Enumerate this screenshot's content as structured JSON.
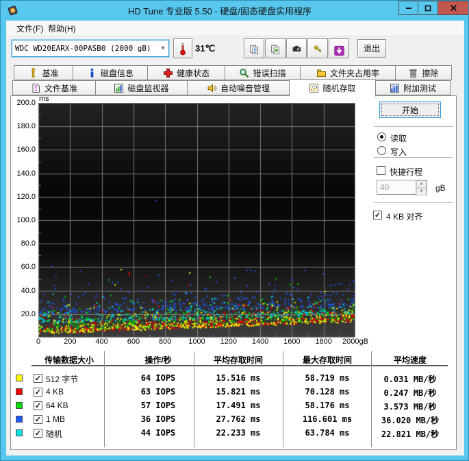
{
  "window": {
    "title": "HD Tune 专业版 5.50 - 硬盘/固态硬盘实用程序",
    "controls": {
      "minimize": "–",
      "maximize": "□",
      "close": "x"
    }
  },
  "menu": {
    "items": [
      "文件(F)",
      "帮助(H)"
    ]
  },
  "toolbar": {
    "drive": "WDC WD20EARX-00PASB0  (2000 gB)",
    "temperature": "31℃",
    "exit_label": "退出",
    "buttons": [
      {
        "icon": "copy-text-icon"
      },
      {
        "icon": "copy-image-icon"
      },
      {
        "icon": "camera-icon"
      },
      {
        "icon": "key-icon"
      },
      {
        "icon": "download-icon"
      }
    ]
  },
  "tabs": {
    "row1": [
      {
        "label": "基准",
        "icon": "benchmark-icon"
      },
      {
        "label": "磁盘信息",
        "icon": "disk-info-icon"
      },
      {
        "label": "健康状态",
        "icon": "health-icon"
      },
      {
        "label": "错误扫描",
        "icon": "error-scan-icon"
      },
      {
        "label": "文件夹占用率",
        "icon": "folder-usage-icon"
      },
      {
        "label": "擦除",
        "icon": "erase-icon"
      }
    ],
    "row2": [
      {
        "label": "文件基准",
        "icon": "file-benchmark-icon"
      },
      {
        "label": "磁盘监视器",
        "icon": "disk-monitor-icon"
      },
      {
        "label": "自动噪音管理",
        "icon": "aam-icon"
      },
      {
        "label": "随机存取",
        "icon": "random-access-icon"
      },
      {
        "label": "附加测试",
        "icon": "extra-tests-icon"
      }
    ],
    "active_row2_index": 3
  },
  "controls": {
    "start_label": "开始",
    "read_label": "读取",
    "write_label": "写入",
    "read_selected": true,
    "short_stroke_label": "快捷行程",
    "short_stroke_checked": false,
    "short_stroke_value": "40",
    "short_stroke_unit": "gB",
    "align_label": "4 KB 对齐",
    "align_checked": true
  },
  "chart_data": {
    "type": "scatter",
    "ylabel": "ms",
    "xlabel_unit": "gB",
    "xlim": [
      0,
      2000
    ],
    "ylim": [
      0,
      200
    ],
    "y_tick_labels": [
      "200.0",
      "180.0",
      "160.0",
      "140.0",
      "120.0",
      "100.0",
      "80.0",
      "60.0",
      "40.0",
      "20.0"
    ],
    "x_tick_labels": [
      "0",
      "200",
      "400",
      "600",
      "800",
      "1000",
      "1200",
      "1400",
      "1600",
      "1800",
      "2000gB"
    ],
    "grid": true,
    "background": {
      "top": "#232323",
      "mid": "#070707",
      "bottom": "#3e3e3e"
    },
    "grid_color": "#7d7d7d",
    "notable_outlier": {
      "series": "1 MB",
      "x_gb": 740,
      "y_ms": 116.6
    },
    "series": [
      {
        "label": "512 字节",
        "color": "#ffff00",
        "checked": true,
        "iops": "64 IOPS",
        "avg_access": "15.516 ms",
        "max_access": "58.719 ms",
        "avg_speed": "0.031 MB/秒",
        "scatter": {
          "count": 430,
          "floor_start": 3,
          "floor_end": 13,
          "mean": 4.5,
          "cap": 58,
          "outliers": 3,
          "omin": 35,
          "omax": 58
        }
      },
      {
        "label": "4 KB",
        "color": "#ff0000",
        "checked": true,
        "iops": "63 IOPS",
        "avg_access": "15.821 ms",
        "max_access": "70.128 ms",
        "avg_speed": "0.247 MB/秒",
        "scatter": {
          "count": 430,
          "floor_start": 3.5,
          "floor_end": 13.5,
          "mean": 4.5,
          "cap": 60,
          "outliers": 4,
          "omin": 35,
          "omax": 60
        }
      },
      {
        "label": "64 KB",
        "color": "#00dc00",
        "checked": true,
        "iops": "57 IOPS",
        "avg_access": "17.491 ms",
        "max_access": "58.176 ms",
        "avg_speed": "3.573 MB/秒",
        "scatter": {
          "count": 420,
          "floor_start": 5,
          "floor_end": 15,
          "mean": 5,
          "cap": 55,
          "outliers": 5,
          "omin": 30,
          "omax": 55
        }
      },
      {
        "label": "1 MB",
        "color": "#1e5aff",
        "checked": true,
        "iops": "36 IOPS",
        "avg_access": "27.762 ms",
        "max_access": "116.601 ms",
        "avg_speed": "36.020 MB/秒",
        "scatter": {
          "count": 360,
          "floor_start": 20,
          "floor_end": 26,
          "mean": 6.5,
          "cap": 60,
          "outliers": 7,
          "omin": 40,
          "omax": 62
        }
      },
      {
        "label": "随机",
        "color": "#00e0e0",
        "checked": true,
        "iops": "44 IOPS",
        "avg_access": "22.233 ms",
        "max_access": "63.784 ms",
        "avg_speed": "22.821 MB/秒",
        "scatter": {
          "count": 360,
          "floor_start": 12,
          "floor_end": 19,
          "mean": 4.5,
          "cap": 42,
          "outliers": 4,
          "omin": 28,
          "omax": 40
        }
      }
    ]
  },
  "table": {
    "headers": [
      "传输数据大小",
      "操作/秒",
      "平均存取时间",
      "最大存取时间",
      "平均速度"
    ]
  }
}
